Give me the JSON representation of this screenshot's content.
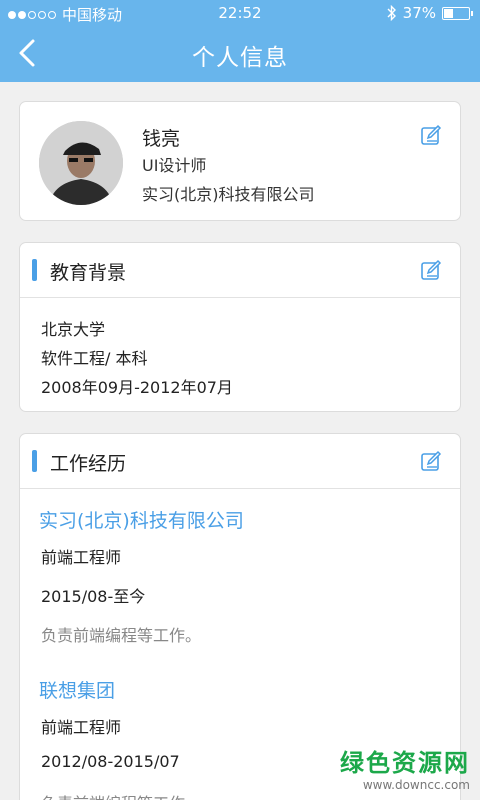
{
  "status_bar": {
    "carrier": "中国移动",
    "time": "22:52",
    "battery": "37%",
    "battery_level": 0.37
  },
  "header": {
    "title": "个人信息"
  },
  "profile": {
    "name": "钱亮",
    "job_title": "UI设计师",
    "company": "实习(北京)科技有限公司"
  },
  "education": {
    "section_title": "教育背景",
    "school": "北京大学",
    "major_degree": "软件工程/ 本科",
    "period": "2008年09月-2012年07月"
  },
  "work": {
    "section_title": "工作经历",
    "jobs": [
      {
        "company": "实习(北京)科技有限公司",
        "position": "前端工程师",
        "period": "2015/08-至今",
        "description": "负责前端编程等工作。"
      },
      {
        "company": "联想集团",
        "position": "前端工程师",
        "period": "2012/08-2015/07",
        "description": "负责前端编程等工作。"
      }
    ]
  },
  "watermark": {
    "text": "绿色资源网",
    "url": "www.downcc.com"
  },
  "colors": {
    "header": "#68b5ec",
    "accent": "#4a9fe6",
    "background": "#f0f0f0"
  }
}
